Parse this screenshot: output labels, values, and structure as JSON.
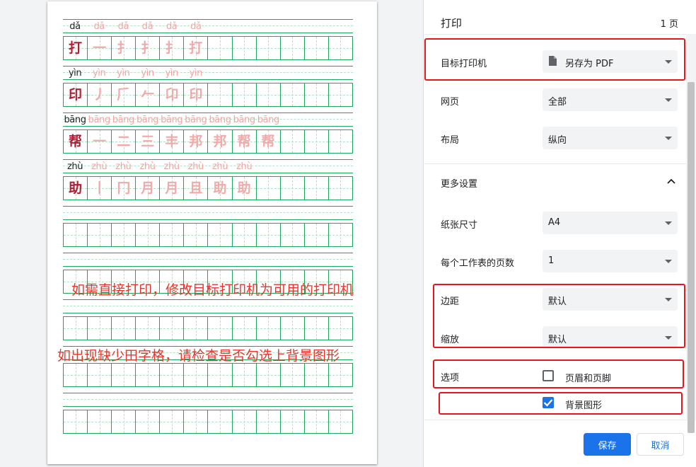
{
  "practice_sheet": {
    "rows": [
      {
        "pinyin": "dǎ",
        "character": "打",
        "strokes": [
          "一",
          "扌",
          "扌",
          "扌",
          "打"
        ]
      },
      {
        "pinyin": "yìn",
        "character": "印",
        "strokes": [
          "丿",
          "𠂆",
          "𠂉",
          "卬",
          "印"
        ]
      },
      {
        "pinyin": "bāng",
        "character": "帮",
        "strokes": [
          "一",
          "二",
          "三",
          "丰",
          "邦",
          "邦",
          "帮",
          "帮"
        ]
      },
      {
        "pinyin": "zhù",
        "character": "助",
        "strokes": [
          "丨",
          "冂",
          "月",
          "月",
          "且",
          "助",
          "助"
        ]
      }
    ],
    "columns": 12,
    "empty_blocks": 5
  },
  "annotations": {
    "tip_printer": "如需直接打印，修改目标打印机为可用的打印机",
    "tip_background": "如出现缺少田字格，请检查是否勾选上背景图形",
    "color": "#e8352c"
  },
  "print_settings": {
    "title": "打印",
    "page_count": "1 页",
    "destination": {
      "label": "目标打印机",
      "value": "另存为 PDF",
      "icon": "document-icon"
    },
    "pages": {
      "label": "网页",
      "value": "全部"
    },
    "layout": {
      "label": "布局",
      "value": "纵向"
    },
    "more_settings": {
      "label": "更多设置",
      "expanded": true
    },
    "paper_size": {
      "label": "纸张尺寸",
      "value": "A4"
    },
    "pages_per_sheet": {
      "label": "每个工作表的页数",
      "value": "1"
    },
    "margins": {
      "label": "边距",
      "value": "默认"
    },
    "scale": {
      "label": "缩放",
      "value": "默认"
    },
    "options": {
      "label": "选项",
      "headers_footers": {
        "label": "页眉和页脚",
        "checked": false
      },
      "background_graphics": {
        "label": "背景图形",
        "checked": true
      }
    }
  },
  "buttons": {
    "save": "保存",
    "cancel": "取消"
  },
  "colors": {
    "accent": "#1a73e8",
    "highlight": "#e8151b",
    "grid": "#1ca85a",
    "character": "#b01e33",
    "trace": "#f3a9a9"
  }
}
